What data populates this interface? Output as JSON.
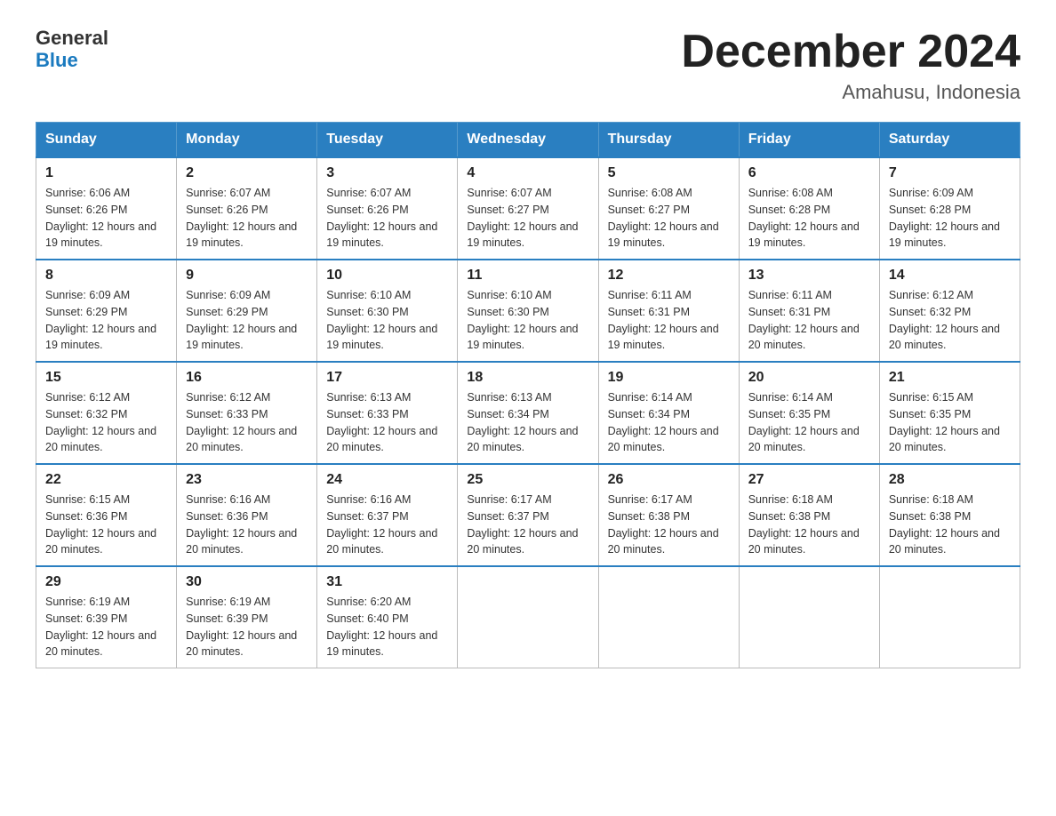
{
  "header": {
    "logo_line1": "General",
    "logo_line2": "Blue",
    "month_title": "December 2024",
    "location": "Amahusu, Indonesia"
  },
  "weekdays": [
    "Sunday",
    "Monday",
    "Tuesday",
    "Wednesday",
    "Thursday",
    "Friday",
    "Saturday"
  ],
  "weeks": [
    [
      {
        "day": "1",
        "sunrise": "6:06 AM",
        "sunset": "6:26 PM",
        "daylight": "12 hours and 19 minutes."
      },
      {
        "day": "2",
        "sunrise": "6:07 AM",
        "sunset": "6:26 PM",
        "daylight": "12 hours and 19 minutes."
      },
      {
        "day": "3",
        "sunrise": "6:07 AM",
        "sunset": "6:26 PM",
        "daylight": "12 hours and 19 minutes."
      },
      {
        "day": "4",
        "sunrise": "6:07 AM",
        "sunset": "6:27 PM",
        "daylight": "12 hours and 19 minutes."
      },
      {
        "day": "5",
        "sunrise": "6:08 AM",
        "sunset": "6:27 PM",
        "daylight": "12 hours and 19 minutes."
      },
      {
        "day": "6",
        "sunrise": "6:08 AM",
        "sunset": "6:28 PM",
        "daylight": "12 hours and 19 minutes."
      },
      {
        "day": "7",
        "sunrise": "6:09 AM",
        "sunset": "6:28 PM",
        "daylight": "12 hours and 19 minutes."
      }
    ],
    [
      {
        "day": "8",
        "sunrise": "6:09 AM",
        "sunset": "6:29 PM",
        "daylight": "12 hours and 19 minutes."
      },
      {
        "day": "9",
        "sunrise": "6:09 AM",
        "sunset": "6:29 PM",
        "daylight": "12 hours and 19 minutes."
      },
      {
        "day": "10",
        "sunrise": "6:10 AM",
        "sunset": "6:30 PM",
        "daylight": "12 hours and 19 minutes."
      },
      {
        "day": "11",
        "sunrise": "6:10 AM",
        "sunset": "6:30 PM",
        "daylight": "12 hours and 19 minutes."
      },
      {
        "day": "12",
        "sunrise": "6:11 AM",
        "sunset": "6:31 PM",
        "daylight": "12 hours and 19 minutes."
      },
      {
        "day": "13",
        "sunrise": "6:11 AM",
        "sunset": "6:31 PM",
        "daylight": "12 hours and 20 minutes."
      },
      {
        "day": "14",
        "sunrise": "6:12 AM",
        "sunset": "6:32 PM",
        "daylight": "12 hours and 20 minutes."
      }
    ],
    [
      {
        "day": "15",
        "sunrise": "6:12 AM",
        "sunset": "6:32 PM",
        "daylight": "12 hours and 20 minutes."
      },
      {
        "day": "16",
        "sunrise": "6:12 AM",
        "sunset": "6:33 PM",
        "daylight": "12 hours and 20 minutes."
      },
      {
        "day": "17",
        "sunrise": "6:13 AM",
        "sunset": "6:33 PM",
        "daylight": "12 hours and 20 minutes."
      },
      {
        "day": "18",
        "sunrise": "6:13 AM",
        "sunset": "6:34 PM",
        "daylight": "12 hours and 20 minutes."
      },
      {
        "day": "19",
        "sunrise": "6:14 AM",
        "sunset": "6:34 PM",
        "daylight": "12 hours and 20 minutes."
      },
      {
        "day": "20",
        "sunrise": "6:14 AM",
        "sunset": "6:35 PM",
        "daylight": "12 hours and 20 minutes."
      },
      {
        "day": "21",
        "sunrise": "6:15 AM",
        "sunset": "6:35 PM",
        "daylight": "12 hours and 20 minutes."
      }
    ],
    [
      {
        "day": "22",
        "sunrise": "6:15 AM",
        "sunset": "6:36 PM",
        "daylight": "12 hours and 20 minutes."
      },
      {
        "day": "23",
        "sunrise": "6:16 AM",
        "sunset": "6:36 PM",
        "daylight": "12 hours and 20 minutes."
      },
      {
        "day": "24",
        "sunrise": "6:16 AM",
        "sunset": "6:37 PM",
        "daylight": "12 hours and 20 minutes."
      },
      {
        "day": "25",
        "sunrise": "6:17 AM",
        "sunset": "6:37 PM",
        "daylight": "12 hours and 20 minutes."
      },
      {
        "day": "26",
        "sunrise": "6:17 AM",
        "sunset": "6:38 PM",
        "daylight": "12 hours and 20 minutes."
      },
      {
        "day": "27",
        "sunrise": "6:18 AM",
        "sunset": "6:38 PM",
        "daylight": "12 hours and 20 minutes."
      },
      {
        "day": "28",
        "sunrise": "6:18 AM",
        "sunset": "6:38 PM",
        "daylight": "12 hours and 20 minutes."
      }
    ],
    [
      {
        "day": "29",
        "sunrise": "6:19 AM",
        "sunset": "6:39 PM",
        "daylight": "12 hours and 20 minutes."
      },
      {
        "day": "30",
        "sunrise": "6:19 AM",
        "sunset": "6:39 PM",
        "daylight": "12 hours and 20 minutes."
      },
      {
        "day": "31",
        "sunrise": "6:20 AM",
        "sunset": "6:40 PM",
        "daylight": "12 hours and 19 minutes."
      },
      null,
      null,
      null,
      null
    ]
  ]
}
